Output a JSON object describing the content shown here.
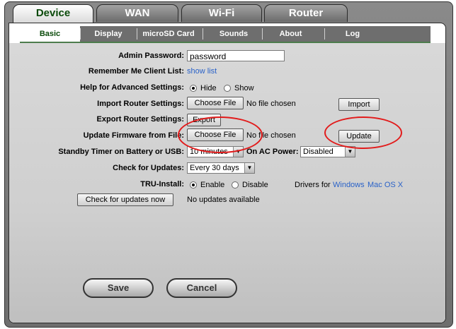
{
  "tabs": [
    {
      "label": "Device",
      "active": true
    },
    {
      "label": "WAN",
      "active": false
    },
    {
      "label": "Wi-Fi",
      "active": false
    },
    {
      "label": "Router",
      "active": false
    }
  ],
  "subtabs": [
    {
      "label": "Basic",
      "active": true
    },
    {
      "label": "Display",
      "active": false
    },
    {
      "label": "microSD Card",
      "active": false
    },
    {
      "label": "Sounds",
      "active": false
    },
    {
      "label": "About",
      "active": false
    },
    {
      "label": "Log",
      "active": false
    }
  ],
  "form": {
    "admin_password_label": "Admin Password:",
    "admin_password_value": "password",
    "remember_label": "Remember Me Client List:",
    "remember_link": "show list",
    "help_label": "Help for Advanced Settings:",
    "help_hide": "Hide",
    "help_show": "Show",
    "import_label": "Import Router Settings:",
    "choose_file": "Choose File",
    "no_file": "No file chosen",
    "import_button": "Import",
    "export_label": "Export Router Settings:",
    "export_button": "Export",
    "firmware_label": "Update Firmware from File:",
    "update_button": "Update",
    "standby_label": "Standby Timer on Battery or USB:",
    "standby_value": "10 minutes",
    "ac_label": "On AC Power:",
    "ac_value": "Disabled",
    "check_label": "Check for Updates:",
    "check_value": "Every 30 days",
    "tru_label": "TRU-Install:",
    "tru_enable": "Enable",
    "tru_disable": "Disable",
    "drivers_text": "Drivers for",
    "drivers_windows": "Windows",
    "drivers_mac": "Mac OS X",
    "check_now_button": "Check for updates now",
    "no_updates": "No updates available"
  },
  "actions": {
    "save": "Save",
    "cancel": "Cancel"
  },
  "colors": {
    "annotation": "#e21b1b",
    "link": "#2a62c8",
    "accent_green": "#0a4a0a"
  }
}
